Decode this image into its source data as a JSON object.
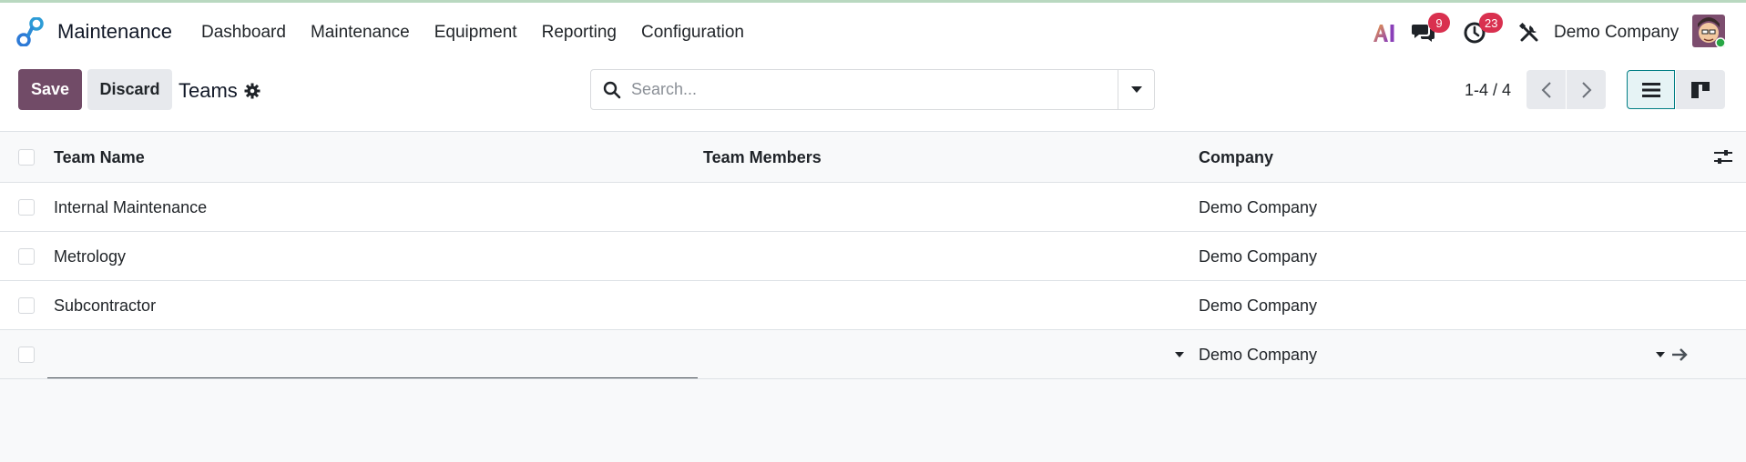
{
  "navbar": {
    "app_name": "Maintenance",
    "menu": [
      "Dashboard",
      "Maintenance",
      "Equipment",
      "Reporting",
      "Configuration"
    ],
    "ai_label": "AI",
    "messages_badge": "9",
    "activities_badge": "23",
    "company": "Demo Company"
  },
  "control_panel": {
    "save_label": "Save",
    "discard_label": "Discard",
    "breadcrumb": "Teams",
    "search_placeholder": "Search...",
    "pager": "1-4 / 4"
  },
  "table": {
    "columns": [
      "Team Name",
      "Team Members",
      "Company"
    ],
    "rows": [
      {
        "name": "Internal Maintenance",
        "members": "",
        "company": "Demo Company"
      },
      {
        "name": "Metrology",
        "members": "",
        "company": "Demo Company"
      },
      {
        "name": "Subcontractor",
        "members": "",
        "company": "Demo Company"
      }
    ],
    "new_row": {
      "name": "",
      "company": "Demo Company"
    }
  },
  "colors": {
    "brand": "#714b67",
    "badge": "#d9304f",
    "active_view": "#017e84",
    "avatar_status": "#28a745"
  },
  "icons": {
    "app": "maintenance-app-icon",
    "chat": "chat-icon",
    "activity": "clock-icon",
    "tools": "tools-icon",
    "settings": "gear-icon",
    "search": "search-icon",
    "list_view": "list-view-icon",
    "kanban_view": "kanban-view-icon",
    "optional_columns": "sliders-icon"
  }
}
